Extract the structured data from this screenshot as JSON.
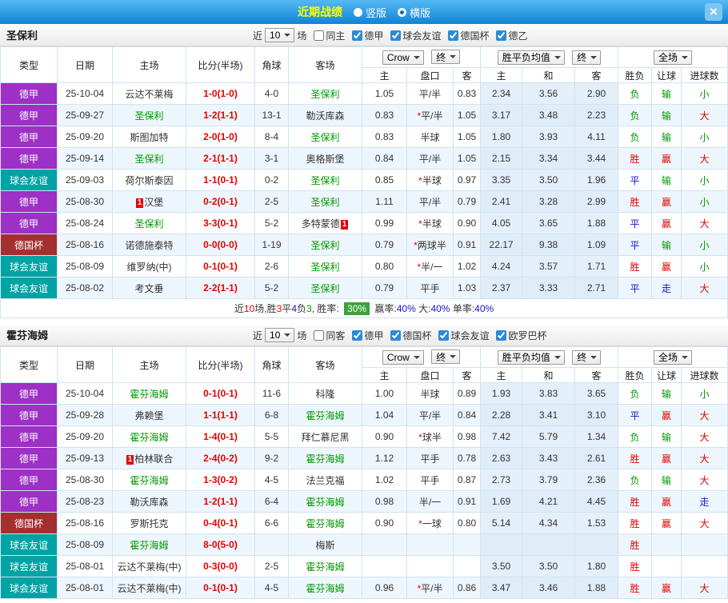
{
  "titlebar": {
    "title": "近期战绩",
    "radios": [
      {
        "label": "竖版",
        "selected": false
      },
      {
        "label": "横版",
        "selected": true
      }
    ],
    "close": "×"
  },
  "labels": {
    "recent_prefix": "近",
    "recent_suffix": "场"
  },
  "controls": {
    "recent_count": "10",
    "company": "Crow",
    "stage": "终",
    "europe_avg": "胜平负均值",
    "stage2": "终",
    "scope": "全场"
  },
  "table_head": {
    "type": "类型",
    "date": "日期",
    "home": "主场",
    "score": "比分(半场)",
    "corner": "角球",
    "away": "客场",
    "asia_home": "主",
    "handicap": "盘口",
    "asia_away": "客",
    "eu_home": "主",
    "eu_draw": "和",
    "eu_away": "客",
    "result": "胜负",
    "let": "让球",
    "goals": "进球数"
  },
  "league_colors": {
    "德甲": "#9d30c5",
    "球会友谊": "#00a3a3",
    "德国杯": "#a52f2f"
  },
  "palette": {
    "red": "#e60000",
    "green": "#009700",
    "blue": "#1414cc"
  },
  "value_colors": {
    "胜": "red",
    "平": "blue",
    "负": "green",
    "赢": "red",
    "输": "green",
    "走": "blue",
    "大": "red",
    "小": "green"
  },
  "sections": [
    {
      "team": "圣保利",
      "filters": {
        "items": [
          {
            "label": "同主",
            "checked": false
          },
          {
            "label": "德甲",
            "checked": true
          },
          {
            "label": "球会友谊",
            "checked": true
          },
          {
            "label": "德国杯",
            "checked": true
          },
          {
            "label": "德乙",
            "checked": true
          }
        ]
      },
      "rows": [
        {
          "league": "德甲",
          "date": "25-10-04",
          "home": "云达不莱梅",
          "away": "圣保利",
          "score": "1-0(1-0)",
          "corner": "4-0",
          "asia_home": "1.05",
          "handicap": "平/半",
          "asia_away": "0.83",
          "euro_home": "2.34",
          "euro_draw": "3.56",
          "euro_away": "2.90",
          "result": "负",
          "let_result": "输",
          "goal_result": "小"
        },
        {
          "league": "德甲",
          "date": "25-09-27",
          "home": "圣保利",
          "away": "勒沃库森",
          "score": "1-2(1-1)",
          "corner": "13-1",
          "asia_home": "0.83",
          "handicap": "*平/半",
          "asia_away": "1.05",
          "euro_home": "3.17",
          "euro_draw": "3.48",
          "euro_away": "2.23",
          "result": "负",
          "let_result": "输",
          "goal_result": "大"
        },
        {
          "league": "德甲",
          "date": "25-09-20",
          "home": "斯图加特",
          "away": "圣保利",
          "score": "2-0(1-0)",
          "corner": "8-4",
          "asia_home": "0.83",
          "handicap": "半球",
          "asia_away": "1.05",
          "euro_home": "1.80",
          "euro_draw": "3.93",
          "euro_away": "4.11",
          "result": "负",
          "let_result": "输",
          "goal_result": "小"
        },
        {
          "league": "德甲",
          "date": "25-09-14",
          "home": "圣保利",
          "away": "奥格斯堡",
          "score": "2-1(1-1)",
          "corner": "3-1",
          "asia_home": "0.84",
          "handicap": "平/半",
          "asia_away": "1.05",
          "euro_home": "2.15",
          "euro_draw": "3.34",
          "euro_away": "3.44",
          "result": "胜",
          "let_result": "赢",
          "goal_result": "大"
        },
        {
          "league": "球会友谊",
          "date": "25-09-03",
          "home": "荷尔斯泰因",
          "away": "圣保利",
          "score": "1-1(0-1)",
          "corner": "0-2",
          "asia_home": "0.85",
          "handicap": "*半球",
          "asia_away": "0.97",
          "euro_home": "3.35",
          "euro_draw": "3.50",
          "euro_away": "1.96",
          "result": "平",
          "let_result": "输",
          "goal_result": "小"
        },
        {
          "league": "德甲",
          "date": "25-08-30",
          "home": "汉堡",
          "home_badge": {
            "text": "1",
            "side": "left"
          },
          "away": "圣保利",
          "score": "0-2(0-1)",
          "corner": "2-5",
          "asia_home": "1.11",
          "handicap": "平/半",
          "asia_away": "0.79",
          "euro_home": "2.41",
          "euro_draw": "3.28",
          "euro_away": "2.99",
          "result": "胜",
          "let_result": "赢",
          "goal_result": "小"
        },
        {
          "league": "德甲",
          "date": "25-08-24",
          "home": "圣保利",
          "away": "多特蒙德",
          "away_badge": {
            "text": "1",
            "side": "right"
          },
          "score": "3-3(0-1)",
          "corner": "5-2",
          "asia_home": "0.99",
          "handicap": "*半球",
          "asia_away": "0.90",
          "euro_home": "4.05",
          "euro_draw": "3.65",
          "euro_away": "1.88",
          "result": "平",
          "let_result": "赢",
          "goal_result": "大"
        },
        {
          "league": "德国杯",
          "date": "25-08-16",
          "home": "诺德施泰特",
          "away": "圣保利",
          "score": "0-0(0-0)",
          "corner": "1-19",
          "asia_home": "0.79",
          "handicap": "*两球半",
          "asia_away": "0.91",
          "euro_home": "22.17",
          "euro_draw": "9.38",
          "euro_away": "1.09",
          "result": "平",
          "let_result": "输",
          "goal_result": "小"
        },
        {
          "league": "球会友谊",
          "date": "25-08-09",
          "home": "维罗纳(中)",
          "away": "圣保利",
          "score": "0-1(0-1)",
          "corner": "2-6",
          "asia_home": "0.80",
          "handicap": "*半/一",
          "asia_away": "1.02",
          "euro_home": "4.24",
          "euro_draw": "3.57",
          "euro_away": "1.71",
          "result": "胜",
          "let_result": "赢",
          "goal_result": "小"
        },
        {
          "league": "球会友谊",
          "date": "25-08-02",
          "home": "考文垂",
          "away": "圣保利",
          "score": "2-2(1-1)",
          "corner": "5-2",
          "asia_home": "0.79",
          "handicap": "平手",
          "asia_away": "1.03",
          "euro_home": "2.37",
          "euro_draw": "3.33",
          "euro_away": "2.71",
          "result": "平",
          "let_result": "走",
          "goal_result": "大"
        }
      ],
      "summary": [
        {
          "t": "近"
        },
        {
          "t": "10",
          "c": "red"
        },
        {
          "t": "场,胜"
        },
        {
          "t": "3",
          "c": "red"
        },
        {
          "t": "平"
        },
        {
          "t": "4",
          "c": "blue"
        },
        {
          "t": "负"
        },
        {
          "t": "3",
          "c": "green"
        },
        {
          "t": ", 胜率: "
        },
        {
          "t": "30%",
          "c": "badge"
        },
        {
          "t": " 赢率:"
        },
        {
          "t": "40%",
          "c": "blue"
        },
        {
          "t": " 大:"
        },
        {
          "t": "40%",
          "c": "blue"
        },
        {
          "t": " 单率:"
        },
        {
          "t": "40%",
          "c": "blue"
        }
      ]
    },
    {
      "team": "霍芬海姆",
      "filters": {
        "items": [
          {
            "label": "同客",
            "checked": false
          },
          {
            "label": "德甲",
            "checked": true
          },
          {
            "label": "德国杯",
            "checked": true
          },
          {
            "label": "球会友谊",
            "checked": true
          },
          {
            "label": "欧罗巴杯",
            "checked": true
          }
        ]
      },
      "rows": [
        {
          "league": "德甲",
          "date": "25-10-04",
          "home": "霍芬海姆",
          "away": "科隆",
          "score": "0-1(0-1)",
          "corner": "11-6",
          "asia_home": "1.00",
          "handicap": "半球",
          "asia_away": "0.89",
          "euro_home": "1.93",
          "euro_draw": "3.83",
          "euro_away": "3.65",
          "result": "负",
          "let_result": "输",
          "goal_result": "小"
        },
        {
          "league": "德甲",
          "date": "25-09-28",
          "home": "弗赖堡",
          "away": "霍芬海姆",
          "score": "1-1(1-1)",
          "corner": "6-8",
          "asia_home": "1.04",
          "handicap": "平/半",
          "asia_away": "0.84",
          "euro_home": "2.28",
          "euro_draw": "3.41",
          "euro_away": "3.10",
          "result": "平",
          "let_result": "赢",
          "goal_result": "大"
        },
        {
          "league": "德甲",
          "date": "25-09-20",
          "home": "霍芬海姆",
          "away": "拜仁慕尼黑",
          "score": "1-4(0-1)",
          "corner": "5-5",
          "asia_home": "0.90",
          "handicap": "*球半",
          "asia_away": "0.98",
          "euro_home": "7.42",
          "euro_draw": "5.79",
          "euro_away": "1.34",
          "result": "负",
          "let_result": "输",
          "goal_result": "大"
        },
        {
          "league": "德甲",
          "date": "25-09-13",
          "home": "柏林联合",
          "home_badge": {
            "text": "1",
            "side": "left"
          },
          "away": "霍芬海姆",
          "score": "2-4(0-2)",
          "corner": "9-2",
          "asia_home": "1.12",
          "handicap": "平手",
          "asia_away": "0.78",
          "euro_home": "2.63",
          "euro_draw": "3.43",
          "euro_away": "2.61",
          "result": "胜",
          "let_result": "赢",
          "goal_result": "大"
        },
        {
          "league": "德甲",
          "date": "25-08-30",
          "home": "霍芬海姆",
          "away": "法兰克福",
          "score": "1-3(0-2)",
          "corner": "4-5",
          "asia_home": "1.02",
          "handicap": "平手",
          "asia_away": "0.87",
          "euro_home": "2.73",
          "euro_draw": "3.79",
          "euro_away": "2.36",
          "result": "负",
          "let_result": "输",
          "goal_result": "大"
        },
        {
          "league": "德甲",
          "date": "25-08-23",
          "home": "勒沃库森",
          "away": "霍芬海姆",
          "score": "1-2(1-1)",
          "corner": "6-4",
          "asia_home": "0.98",
          "handicap": "半/一",
          "asia_away": "0.91",
          "euro_home": "1.69",
          "euro_draw": "4.21",
          "euro_away": "4.45",
          "result": "胜",
          "let_result": "赢",
          "goal_result": "走"
        },
        {
          "league": "德国杯",
          "date": "25-08-16",
          "home": "罗斯托克",
          "away": "霍芬海姆",
          "score": "0-4(0-1)",
          "corner": "6-6",
          "asia_home": "0.90",
          "handicap": "*一球",
          "asia_away": "0.80",
          "euro_home": "5.14",
          "euro_draw": "4.34",
          "euro_away": "1.53",
          "result": "胜",
          "let_result": "赢",
          "goal_result": "大"
        },
        {
          "league": "球会友谊",
          "date": "25-08-09",
          "home": "霍芬海姆",
          "away": "梅斯",
          "score": "8-0(5-0)",
          "corner": "",
          "asia_home": "",
          "handicap": "",
          "asia_away": "",
          "euro_home": "",
          "euro_draw": "",
          "euro_away": "",
          "result": "胜",
          "let_result": "",
          "goal_result": ""
        },
        {
          "league": "球会友谊",
          "date": "25-08-01",
          "home": "云达不莱梅(中)",
          "away": "霍芬海姆",
          "score": "0-3(0-0)",
          "corner": "2-5",
          "asia_home": "",
          "handicap": "",
          "asia_away": "",
          "euro_home": "3.50",
          "euro_draw": "3.50",
          "euro_away": "1.80",
          "result": "胜",
          "let_result": "",
          "goal_result": ""
        },
        {
          "league": "球会友谊",
          "date": "25-08-01",
          "home": "云达不莱梅(中)",
          "away": "霍芬海姆",
          "score": "0-1(0-1)",
          "corner": "4-5",
          "asia_home": "0.96",
          "handicap": "*平/半",
          "asia_away": "0.86",
          "euro_home": "3.47",
          "euro_draw": "3.46",
          "euro_away": "1.88",
          "result": "胜",
          "let_result": "赢",
          "goal_result": "大"
        }
      ],
      "summary": []
    }
  ]
}
